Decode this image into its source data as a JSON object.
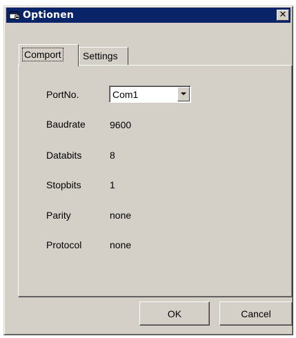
{
  "window": {
    "title": "Optionen",
    "icon": "app-window-icon",
    "close_label": "✕"
  },
  "tabs": [
    {
      "label": "Comport",
      "selected": true
    },
    {
      "label": "Settings",
      "selected": false
    }
  ],
  "comport": {
    "portno": {
      "label": "PortNo.",
      "value": "Com1"
    },
    "baudrate": {
      "label": "Baudrate",
      "value": "9600"
    },
    "databits": {
      "label": "Databits",
      "value": "8"
    },
    "stopbits": {
      "label": "Stopbits",
      "value": "1"
    },
    "parity": {
      "label": "Parity",
      "value": "none"
    },
    "protocol": {
      "label": "Protocol",
      "value": "none"
    }
  },
  "buttons": {
    "ok": "OK",
    "cancel": "Cancel"
  },
  "colors": {
    "titlebar": "#0a246a",
    "face": "#d4d0c8"
  }
}
